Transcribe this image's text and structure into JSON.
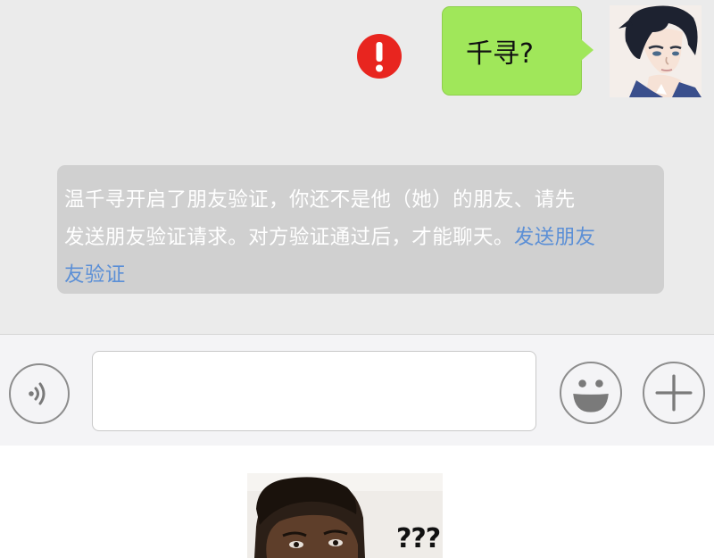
{
  "chat": {
    "outgoing_message": "千寻?",
    "send_failed_icon": "exclamation-circle-icon",
    "system_notice": {
      "line1": "温千寻开启了朋友验证，你还不是他（她）的朋友、请先",
      "line2": "发送朋友验证请求。对方验证通过后，才能聊天。",
      "link_part1": "发送朋友",
      "link_part2": "友验证"
    }
  },
  "input_bar": {
    "voice_icon": "voice-icon",
    "text_value": "",
    "emoji_icon": "emoji-icon",
    "plus_icon": "plus-icon"
  },
  "meme": {
    "caption": "???"
  },
  "colors": {
    "bubble_green": "#a0e75a",
    "error_red": "#e8251f",
    "link_blue": "#5b8fd6",
    "chat_background": "#ebebeb"
  }
}
